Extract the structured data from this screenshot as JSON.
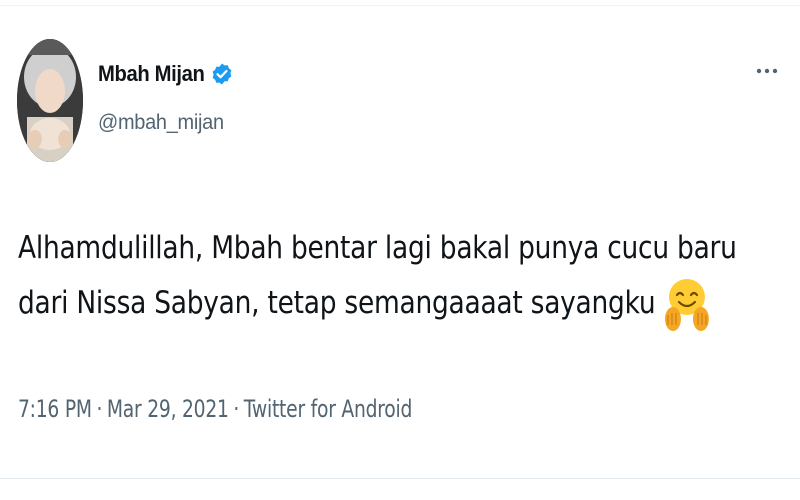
{
  "author": {
    "display_name": "Mbah Mijan",
    "handle": "@mbah_mijan",
    "verified": true,
    "verified_color": "#1d9bf0",
    "avatar_icon": "profile-photo"
  },
  "tweet": {
    "line1": "Alhamdulillah, Mbah bentar lagi bakal punya cucu baru",
    "line2": "dari Nissa Sabyan, tetap semangaaaat sayangku",
    "emoji": "hugging-face-emoji"
  },
  "meta": {
    "time": "7:16 PM",
    "separator": "·",
    "date": "Mar 29, 2021",
    "source": "Twitter for Android"
  },
  "actions": {
    "more_icon": "more-dots-icon"
  },
  "colors": {
    "text": "#0f1419",
    "secondary": "#536471",
    "divider": "#eff3f4"
  }
}
